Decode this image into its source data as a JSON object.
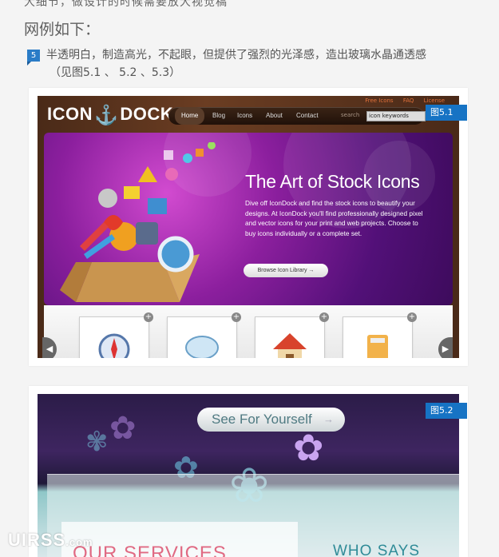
{
  "article": {
    "clipped_top_text": "大细节，做设计的时候需要放大视觉稿",
    "section_title": "网例如下：",
    "item_number": "5",
    "item_text": "半透明白，制造高光，不起眼，但提供了强烈的光泽感，造出玻璃水晶通透感",
    "item_ref": "（见图5.1 、 5.2 、5.3）"
  },
  "figure1": {
    "badge": "图5.1",
    "site": {
      "logo_left": "ICON",
      "logo_right": "DOCK",
      "top_links": [
        "Free Icons",
        "FAQ",
        "License"
      ],
      "nav": [
        "Home",
        "Blog",
        "Icons",
        "About",
        "Contact"
      ],
      "search_label": "search",
      "search_value": "icon keywords",
      "hero_title": "The Art of Stock Icons",
      "hero_text": "Dive off IconDock and find the stock icons to beautify your designs. At IconDock you'll find professionally designed pixel and vector icons for your print and web projects. Choose to buy icons individually or a complete set.",
      "hero_button": "Browse Icon Library  →",
      "card_plus": "+",
      "prev_arrow": "◀",
      "next_arrow": "▶"
    }
  },
  "figure2": {
    "badge": "图5.2",
    "site": {
      "pill_button": "See For Yourself",
      "pill_arrow": "→",
      "services": "OUR SERVICES",
      "who": "WHO SAYS YOU"
    }
  },
  "watermark": {
    "main": "UIRSS",
    "suffix": ".com"
  },
  "colors": {
    "badge_blue": "#1673c4",
    "hero_purple": "#8c1f9e",
    "wood_brown": "#6b3d22"
  }
}
